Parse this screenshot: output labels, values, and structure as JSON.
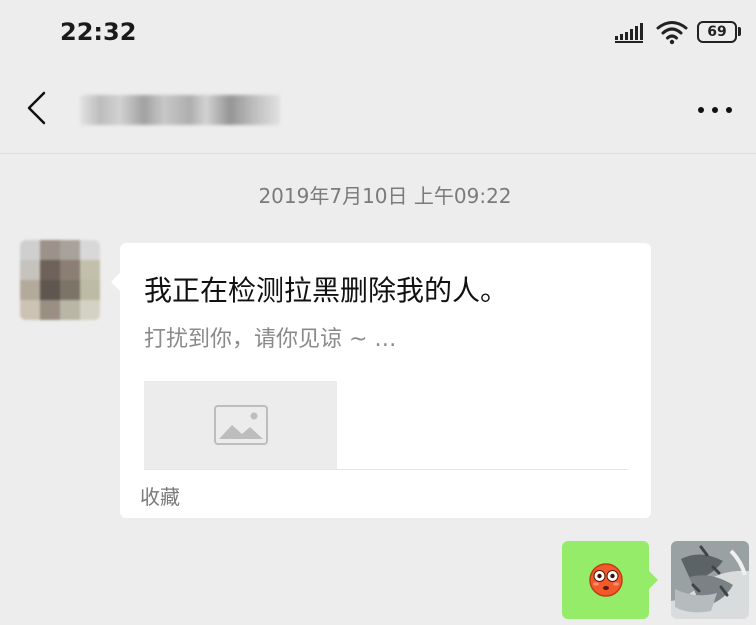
{
  "status_bar": {
    "time": "22:32",
    "battery": "69",
    "icons": [
      "signal-icon",
      "wifi-icon",
      "battery-icon"
    ]
  },
  "nav": {
    "back_icon": "back-chevron-icon",
    "title_blurred": true,
    "more_icon": "more-dots-icon"
  },
  "chat": {
    "timestamp": "2019年7月10日 上午09:22",
    "messages": [
      {
        "direction": "incoming",
        "type": "link-card",
        "title": "我正在检测拉黑删除我的人。",
        "description": "打扰到你，请你见谅 ~ …",
        "thumbnail_icon": "image-placeholder-icon",
        "source": "收藏"
      },
      {
        "direction": "outgoing",
        "type": "emoji",
        "emoji": "😳"
      }
    ]
  },
  "colors": {
    "background": "#ededed",
    "outgoing_bubble": "#95ec69",
    "incoming_bubble": "#ffffff"
  }
}
